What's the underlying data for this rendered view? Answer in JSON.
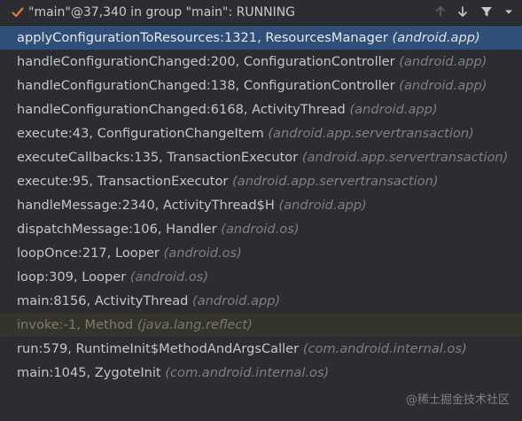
{
  "header": {
    "thread_title": "\"main\"@37,340 in group \"main\": RUNNING",
    "icons": [
      "checkmark-icon",
      "arrow-up-icon",
      "arrow-down-icon",
      "filter-icon",
      "dropdown-icon"
    ]
  },
  "frames": [
    {
      "method": "applyConfigurationToResources:1321, ResourcesManager",
      "package": "(android.app)",
      "state": "selected"
    },
    {
      "method": "handleConfigurationChanged:200, ConfigurationController",
      "package": "(android.app)",
      "state": "normal"
    },
    {
      "method": "handleConfigurationChanged:138, ConfigurationController",
      "package": "(android.app)",
      "state": "normal"
    },
    {
      "method": "handleConfigurationChanged:6168, ActivityThread",
      "package": "(android.app)",
      "state": "normal"
    },
    {
      "method": "execute:43, ConfigurationChangeItem",
      "package": "(android.app.servertransaction)",
      "state": "normal"
    },
    {
      "method": "executeCallbacks:135, TransactionExecutor",
      "package": "(android.app.servertransaction)",
      "state": "normal"
    },
    {
      "method": "execute:95, TransactionExecutor",
      "package": "(android.app.servertransaction)",
      "state": "normal"
    },
    {
      "method": "handleMessage:2340, ActivityThread$H",
      "package": "(android.app)",
      "state": "normal"
    },
    {
      "method": "dispatchMessage:106, Handler",
      "package": "(android.os)",
      "state": "normal"
    },
    {
      "method": "loopOnce:217, Looper",
      "package": "(android.os)",
      "state": "normal"
    },
    {
      "method": "loop:309, Looper",
      "package": "(android.os)",
      "state": "normal"
    },
    {
      "method": "main:8156, ActivityThread",
      "package": "(android.app)",
      "state": "normal"
    },
    {
      "method": "invoke:-1, Method",
      "package": "(java.lang.reflect)",
      "state": "library"
    },
    {
      "method": "run:579, RuntimeInit$MethodAndArgsCaller",
      "package": "(com.android.internal.os)",
      "state": "normal"
    },
    {
      "method": "main:1045, ZygoteInit",
      "package": "(com.android.internal.os)",
      "state": "normal"
    }
  ],
  "watermark": "@稀土掘金技术社区",
  "colors": {
    "background": "#2b2d30",
    "selected_row": "#2f4f78",
    "library_row": "#35342c",
    "checkmark": "#e8793b"
  }
}
